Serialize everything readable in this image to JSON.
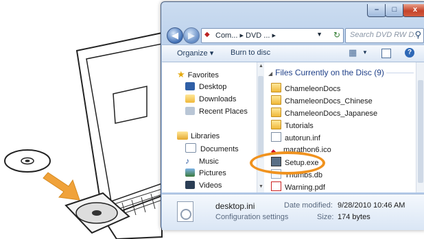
{
  "window": {
    "address_crumbs": "Com... ▸ DVD ... ▸",
    "search_placeholder": "Search DVD RW D..."
  },
  "toolbar": {
    "organize": "Organize ▾",
    "burn": "Burn to disc"
  },
  "navigation": {
    "favorites": "Favorites",
    "favorites_items": [
      "Desktop",
      "Downloads",
      "Recent Places"
    ],
    "libraries": "Libraries",
    "libraries_items": [
      "Documents",
      "Music",
      "Pictures",
      "Videos"
    ]
  },
  "files": {
    "group_header": "Files Currently on the Disc (9)",
    "items": [
      {
        "name": "ChameleonDocs",
        "icon": "folder-icon"
      },
      {
        "name": "ChameleonDocs_Chinese",
        "icon": "folder-icon"
      },
      {
        "name": "ChameleonDocs_Japanese",
        "icon": "folder-icon"
      },
      {
        "name": "Tutorials",
        "icon": "folder-icon"
      },
      {
        "name": "autorun.inf",
        "icon": "settings-file-icon"
      },
      {
        "name": "marathon6.ico",
        "icon": "icon-file-icon"
      },
      {
        "name": "Setup.exe",
        "icon": "installer-icon"
      },
      {
        "name": "Thumbs.db",
        "icon": "database-file-icon"
      },
      {
        "name": "Warning.pdf",
        "icon": "pdf-icon"
      }
    ]
  },
  "details": {
    "name": "desktop.ini",
    "type": "Configuration settings",
    "modified_label": "Date modified:",
    "modified_value": "9/28/2010 10:46 AM",
    "size_label": "Size:",
    "size_value": "174 bytes"
  },
  "colors": {
    "highlight": "#f0921e",
    "arrow": "#f0a23a",
    "group_header": "#1e3f88"
  }
}
